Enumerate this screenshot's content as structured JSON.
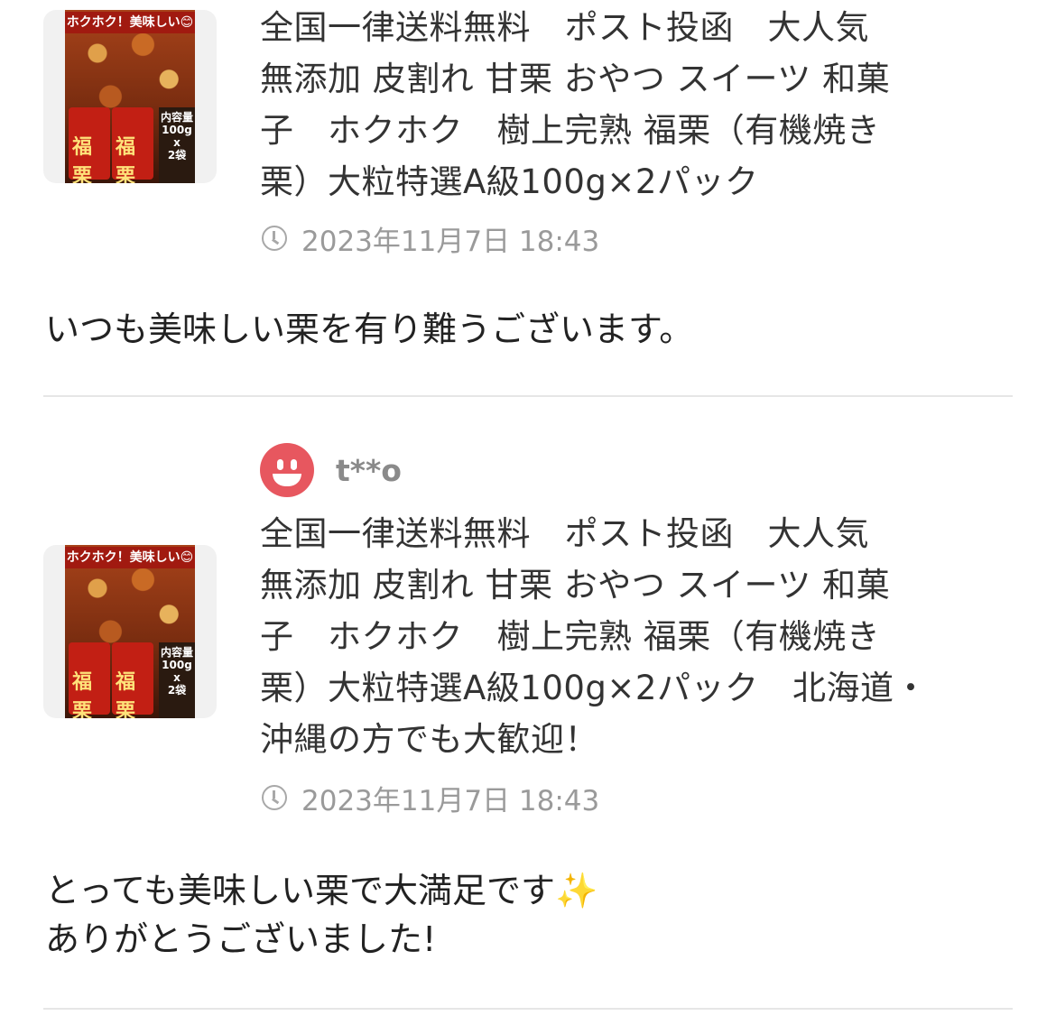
{
  "reviews": [
    {
      "product_image": {
        "banner": "ホクホク！美味しい😊",
        "pack_text": "福栗",
        "qty": "内容量\n100g\nx\n2袋"
      },
      "title": "全国一律送料無料　ポスト投函　大人気\n無添加 皮割れ 甘栗 おやつ スイーツ 和菓\n子　ホクホク　樹上完熟 福栗（有機焼き\n栗）大粒特選A級100g×2パック",
      "date": "2023年11月7日 18:43",
      "comment": "いつも美味しい栗を有り難うございます。"
    },
    {
      "user": {
        "name": "t**o"
      },
      "product_image": {
        "banner": "ホクホク！美味しい😊",
        "pack_text": "福栗",
        "qty": "内容量\n100g\nx\n2袋"
      },
      "title": "全国一律送料無料　ポスト投函　大人気\n無添加 皮割れ 甘栗 おやつ スイーツ 和菓\n子　ホクホク　樹上完熟 福栗（有機焼き\n栗）大粒特選A級100g×2パック　北海道・\n沖縄の方でも大歓迎！",
      "date": "2023年11月7日 18:43",
      "comment": "とっても美味しい栗で大満足です✨\nありがとうございました!"
    }
  ]
}
